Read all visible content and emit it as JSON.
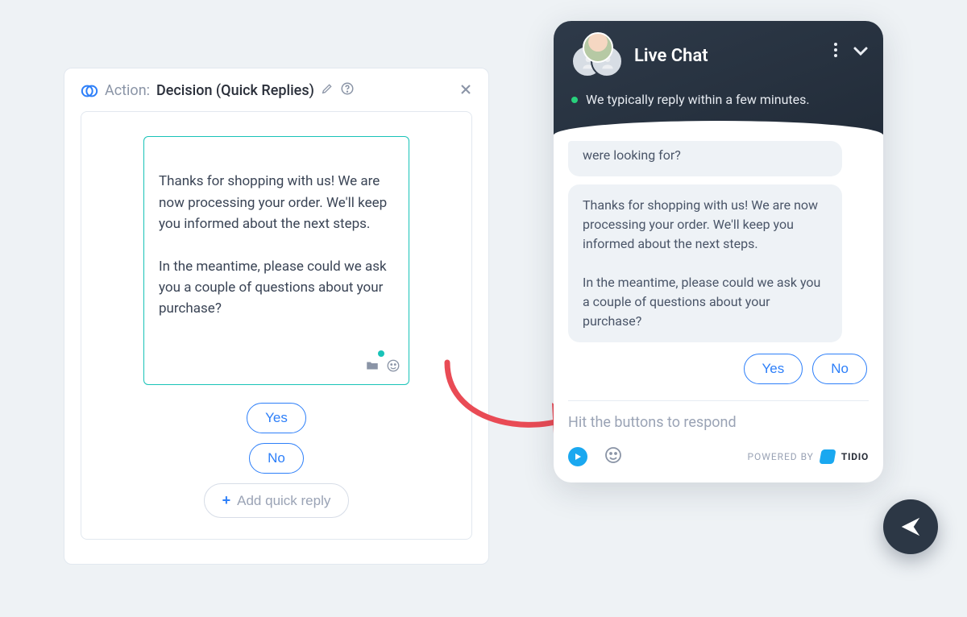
{
  "builder": {
    "action_label": "Action:",
    "action_name": "Decision (Quick Replies)",
    "message": "Thanks for shopping with us!  We are now processing your order.  We'll keep you informed about the next steps.\n\nIn the meantime, please could we ask you a couple of questions about your purchase?",
    "quick_replies": {
      "yes": "Yes",
      "no": "No"
    },
    "add_quick_reply": "Add quick reply"
  },
  "chat": {
    "title": "Live Chat",
    "status": "We typically reply within a few minutes.",
    "prev_snippet": "were looking for?",
    "message": "Thanks for shopping with us! We are now processing your order. We'll keep you informed about the next steps.\n\nIn the meantime, please could we ask you a couple of questions about your purchase?",
    "quick_replies": {
      "yes": "Yes",
      "no": "No"
    },
    "input_placeholder": "Hit the buttons to respond",
    "powered_by": "POWERED BY",
    "brand": "TIDIO"
  }
}
